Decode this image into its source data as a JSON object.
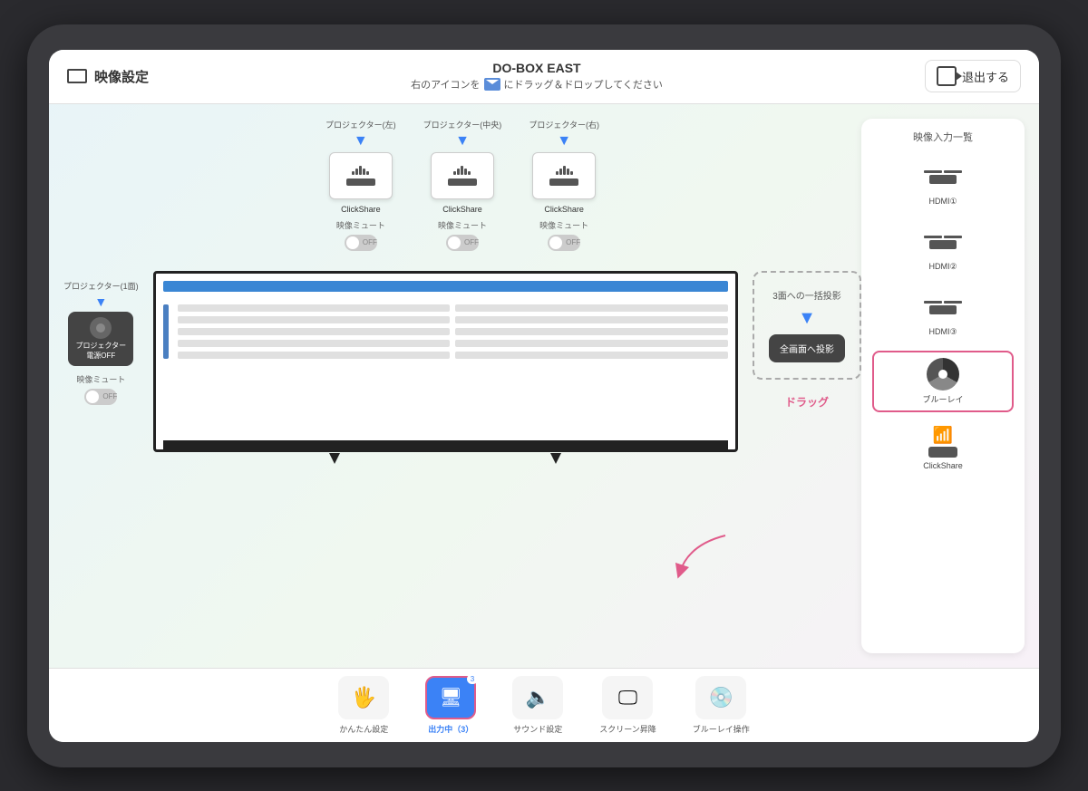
{
  "app": {
    "title": "DO-BOX EAST",
    "subtitle": "右のアイコンを",
    "subtitle2": "にドラッグ＆ドロップしてください",
    "page_title": "映像設定",
    "exit_label": "退出する"
  },
  "projectors_top": [
    {
      "label": "プロジェクター(左)",
      "name": "ClickShare"
    },
    {
      "label": "プロジェクター(中央)",
      "name": "ClickShare"
    },
    {
      "label": "プロジェクター(右)",
      "name": "ClickShare"
    }
  ],
  "mute_labels": [
    "映像ミュート",
    "映像ミュート",
    "映像ミュート"
  ],
  "toggle_label": "OFF",
  "projector_left": {
    "label": "プロジェクター(1面)",
    "name": "プロジェクター\n電源OFF",
    "mute_label": "映像ミュート"
  },
  "bulk_projection": {
    "label": "3面への一括投影",
    "button_label": "全画面へ投影",
    "drag_label": "ドラッグ"
  },
  "right_panel": {
    "title": "映像入力一覧",
    "items": [
      {
        "label": "HDMI①",
        "type": "hdmi"
      },
      {
        "label": "HDMI②",
        "type": "hdmi"
      },
      {
        "label": "HDMI③",
        "type": "hdmi"
      },
      {
        "label": "ブルーレイ",
        "type": "bluray",
        "highlighted": true
      },
      {
        "label": "ClickShare",
        "type": "clickshare"
      }
    ]
  },
  "bottom_nav": {
    "items": [
      {
        "label": "かんたん設定",
        "icon": "hand",
        "active": false
      },
      {
        "label": "出力中（3）",
        "icon": "monitor",
        "active": true,
        "badge": "3"
      },
      {
        "label": "サウンド設定",
        "icon": "sound",
        "active": false
      },
      {
        "label": "スクリーン昇降",
        "icon": "screen",
        "active": false
      },
      {
        "label": "ブルーレイ操作",
        "icon": "disc",
        "active": false
      }
    ]
  }
}
